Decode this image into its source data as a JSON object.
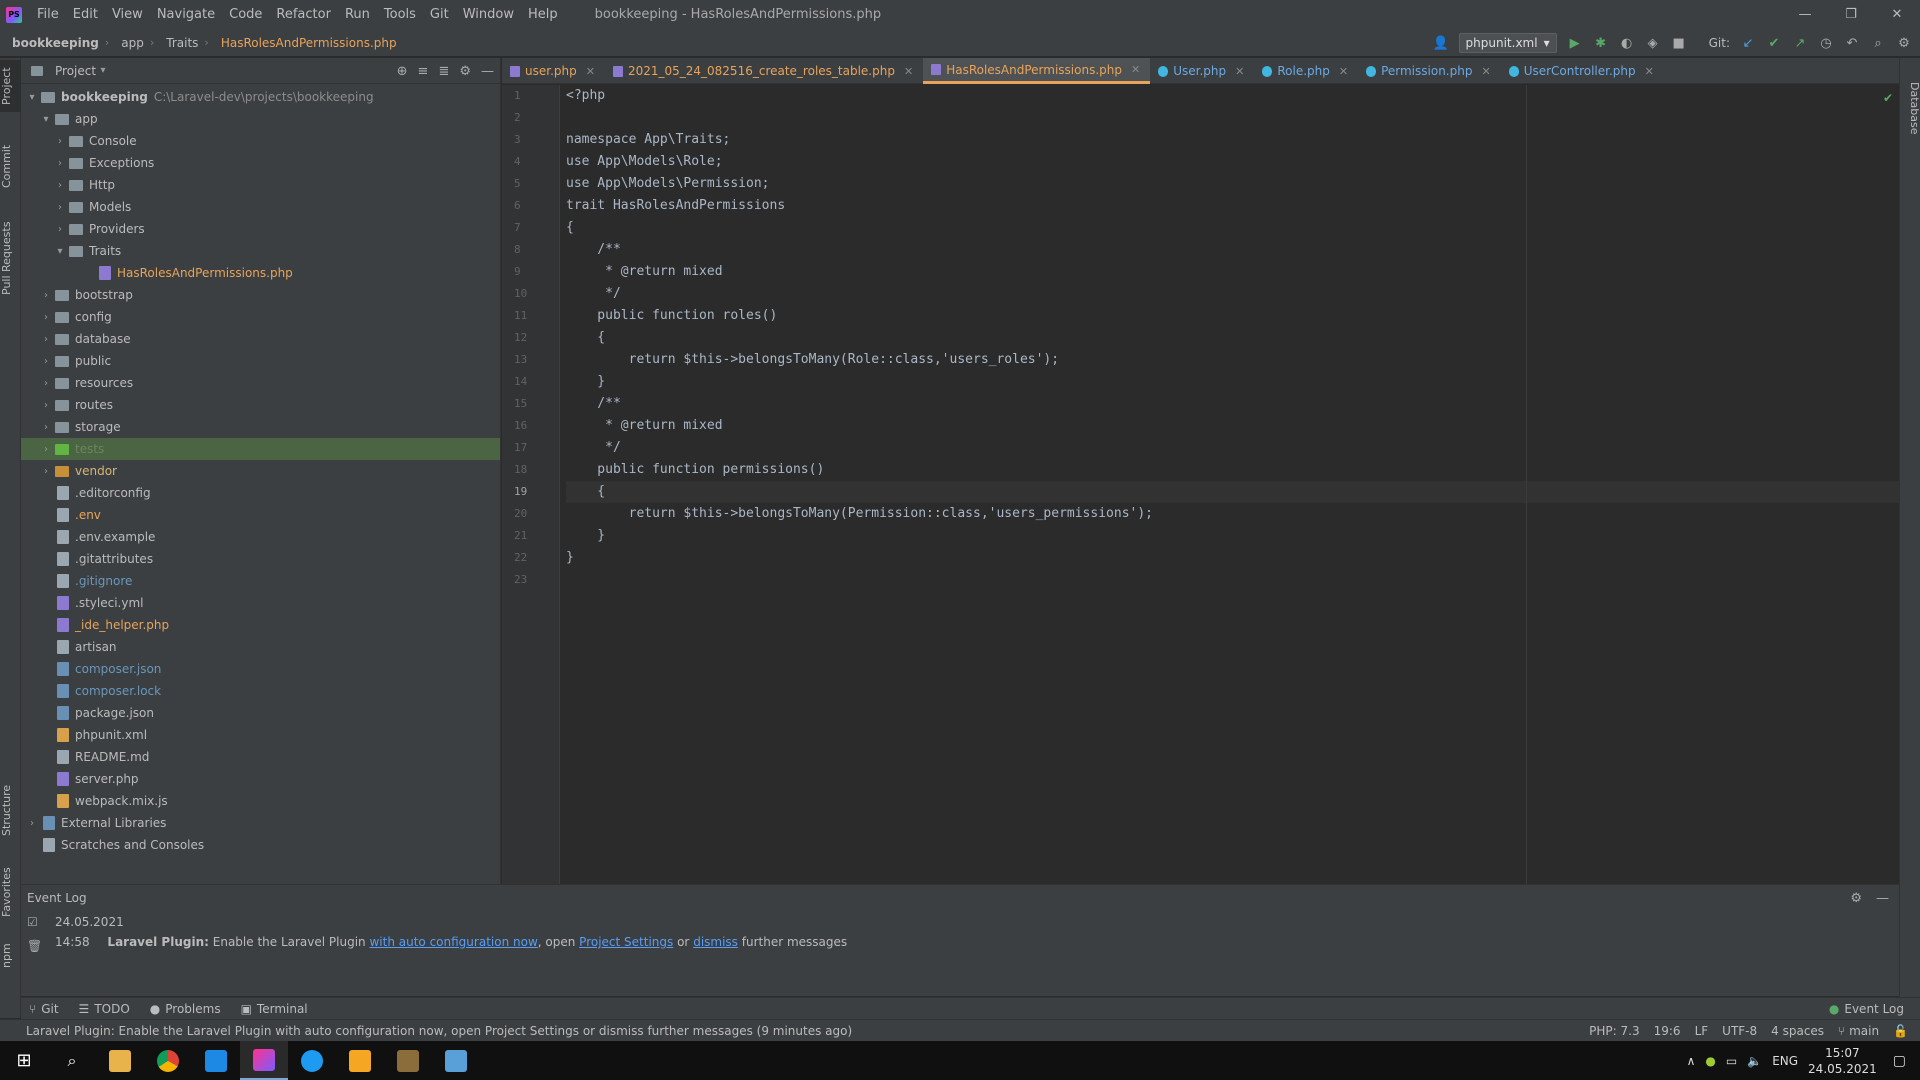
{
  "window": {
    "title": "bookkeeping - HasRolesAndPermissions.php",
    "menu": [
      "File",
      "Edit",
      "View",
      "Navigate",
      "Code",
      "Refactor",
      "Run",
      "Tools",
      "Git",
      "Window",
      "Help"
    ],
    "app_logo": "PS"
  },
  "navbar": {
    "breadcrumbs": [
      "bookkeeping",
      "app",
      "Traits",
      "HasRolesAndPermissions.php"
    ],
    "run_config": "phpunit.xml",
    "git_label": "Git:"
  },
  "left_strip": [
    "Project",
    "Commit",
    "Pull Requests",
    "Structure",
    "Favorites",
    "npm"
  ],
  "right_strip": [
    "Database"
  ],
  "project": {
    "title": "Project",
    "root_name": "bookkeeping",
    "root_path": "C:\\Laravel-dev\\projects\\bookkeeping",
    "app": "app",
    "app_children": [
      "Console",
      "Exceptions",
      "Http",
      "Models",
      "Providers"
    ],
    "traits": "Traits",
    "traits_file": "HasRolesAndPermissions.php",
    "folders": [
      "bootstrap",
      "config",
      "database",
      "public",
      "resources",
      "routes",
      "storage",
      "tests",
      "vendor"
    ],
    "files": [
      ".editorconfig",
      ".env",
      ".env.example",
      ".gitattributes",
      ".gitignore",
      ".styleci.yml",
      "_ide_helper.php",
      "artisan",
      "composer.json",
      "composer.lock",
      "package.json",
      "phpunit.xml",
      "README.md",
      "server.php",
      "webpack.mix.js"
    ],
    "external_libraries": "External Libraries",
    "scratches": "Scratches and Consoles"
  },
  "tabs": [
    {
      "label": "user.php",
      "kind": "php"
    },
    {
      "label": "2021_05_24_082516_create_roles_table.php",
      "kind": "php"
    },
    {
      "label": "HasRolesAndPermissions.php",
      "kind": "php",
      "active": true
    },
    {
      "label": "User.php",
      "kind": "class"
    },
    {
      "label": "Role.php",
      "kind": "class"
    },
    {
      "label": "Permission.php",
      "kind": "class"
    },
    {
      "label": "UserController.php",
      "kind": "class"
    }
  ],
  "editor": {
    "current_line": 19,
    "lines": [
      "<?php",
      "",
      "namespace App\\Traits;",
      "use App\\Models\\Role;",
      "use App\\Models\\Permission;",
      "trait HasRolesAndPermissions",
      "{",
      "    /**",
      "     * @return mixed",
      "     */",
      "    public function roles()",
      "    {",
      "        return $this->belongsToMany(Role::class,'users_roles');",
      "    }",
      "    /**",
      "     * @return mixed",
      "     */",
      "    public function permissions()",
      "    {",
      "        return $this->belongsToMany(Permission::class,'users_permissions');",
      "    }",
      "}",
      ""
    ]
  },
  "event_log": {
    "title": "Event Log",
    "date": "24.05.2021",
    "time": "14:58",
    "plugin": "Laravel Plugin:",
    "msg_before": "Enable the Laravel Plugin",
    "link1": "with auto configuration now",
    "msg_mid1": ", open",
    "link2": "Project Settings",
    "msg_mid2": "or",
    "link3": "dismiss",
    "msg_after": "further messages"
  },
  "tool_tabs": [
    "Git",
    "TODO",
    "Problems",
    "Terminal"
  ],
  "tool_tab_right": "Event Log",
  "status": {
    "message": "Laravel Plugin: Enable the Laravel Plugin with auto configuration now, open Project Settings or dismiss further messages (9 minutes ago)",
    "php": "PHP: 7.3",
    "position": "19:6",
    "line_sep": "LF",
    "encoding": "UTF-8",
    "indent": "4 spaces",
    "branch": "main"
  },
  "taskbar": {
    "lang": "ENG",
    "time": "15:07",
    "date": "24.05.2021"
  }
}
